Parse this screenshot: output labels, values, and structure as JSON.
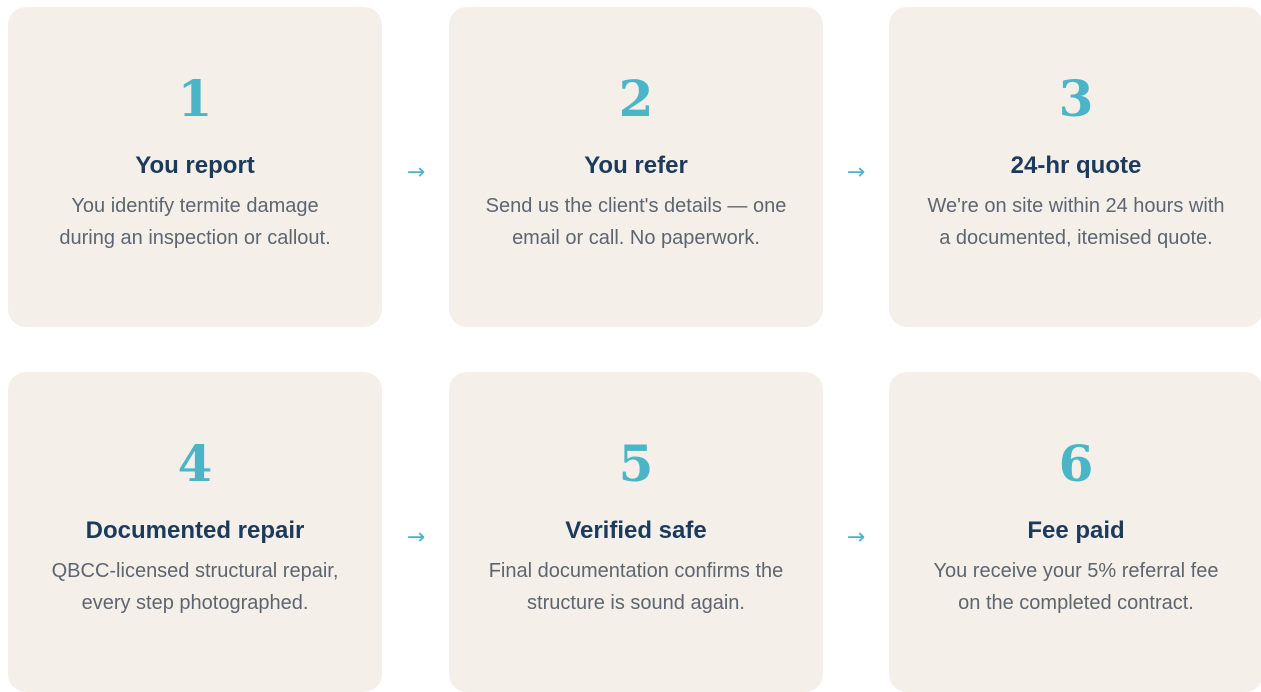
{
  "steps": [
    {
      "number": "1",
      "title": "You report",
      "description": "You identify termite damage during an inspection or callout."
    },
    {
      "number": "2",
      "title": "You refer",
      "description": "Send us the client's details — one email or call. No paperwork."
    },
    {
      "number": "3",
      "title": "24-hr quote",
      "description": "We're on site within 24 hours with a documented, itemised quote."
    },
    {
      "number": "4",
      "title": "Documented repair",
      "description": "QBCC-licensed structural repair, every step photographed."
    },
    {
      "number": "5",
      "title": "Verified safe",
      "description": "Final documentation confirms the structure is sound again."
    },
    {
      "number": "6",
      "title": "Fee paid",
      "description": "You receive your 5% referral fee on the completed contract."
    }
  ],
  "arrow_glyph": "→",
  "colors": {
    "card_background": "#f4efe9",
    "accent": "#4bb5c8",
    "title": "#1c3a5c",
    "body_text": "#5d6670"
  }
}
